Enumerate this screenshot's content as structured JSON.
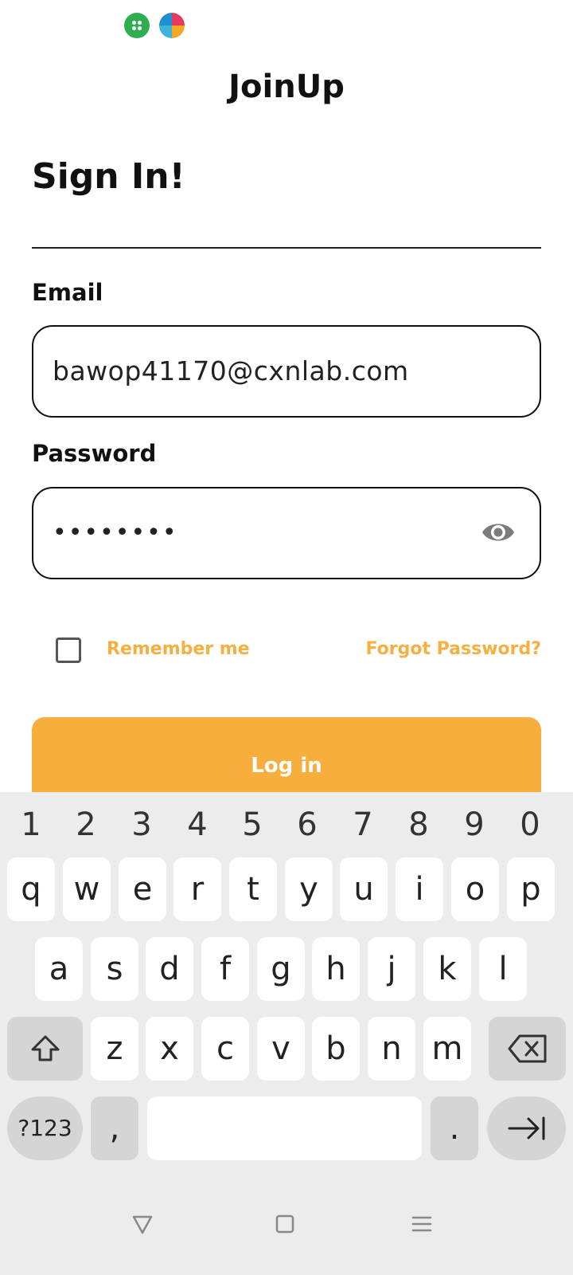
{
  "app": {
    "title": "JoinUp"
  },
  "signin": {
    "heading": "Sign In!",
    "email_label": "Email",
    "email_value": "bawop41170@cxnlab.com",
    "password_label": "Password",
    "password_value": "••••••••",
    "remember_label": "Remember me",
    "forgot_label": "Forgot Password?",
    "login_label": "Log in"
  },
  "keyboard": {
    "numbers": [
      "1",
      "2",
      "3",
      "4",
      "5",
      "6",
      "7",
      "8",
      "9",
      "0"
    ],
    "row1": [
      "q",
      "w",
      "e",
      "r",
      "t",
      "y",
      "u",
      "i",
      "o",
      "p"
    ],
    "row2": [
      "a",
      "s",
      "d",
      "f",
      "g",
      "h",
      "j",
      "k",
      "l"
    ],
    "row3": [
      "z",
      "x",
      "c",
      "v",
      "b",
      "n",
      "m"
    ],
    "symbols_label": "?123",
    "comma_label": ",",
    "period_label": "."
  },
  "colors": {
    "accent": "#f8ae3c",
    "link": "#f4b040"
  }
}
